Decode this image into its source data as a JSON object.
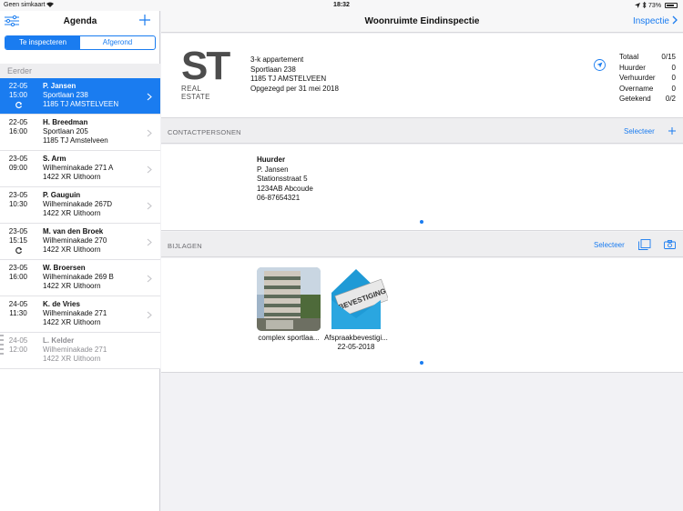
{
  "status_bar": {
    "carrier": "Geen simkaart",
    "time": "18:32",
    "battery": "73%"
  },
  "sidebar": {
    "title": "Agenda",
    "segments": [
      "Te inspecteren",
      "Afgerond"
    ],
    "section": "Eerder",
    "rows": [
      {
        "date": "22-05",
        "time": "15:00",
        "name": "P. Jansen",
        "street": "Sportlaan 238",
        "city": "1185 TJ AMSTELVEEN"
      },
      {
        "date": "22-05",
        "time": "16:00",
        "name": "H. Breedman",
        "street": "Sportlaan 205",
        "city": "1185 TJ Amstelveen"
      },
      {
        "date": "23-05",
        "time": "09:00",
        "name": "S. Arm",
        "street": "Wilheminakade 271 A",
        "city": "1422 XR Uithoorn"
      },
      {
        "date": "23-05",
        "time": "10:30",
        "name": "P. Gauguin",
        "street": "Wilheminakade 267D",
        "city": "1422 XR Uithoorn"
      },
      {
        "date": "23-05",
        "time": "15:15",
        "name": "M. van den Broek",
        "street": "Wilheminakade 270",
        "city": "1422 XR Uithoorn"
      },
      {
        "date": "23-05",
        "time": "16:00",
        "name": "W. Broersen",
        "street": "Wilheminakade 269 B",
        "city": "1422 XR Uithoorn"
      },
      {
        "date": "24-05",
        "time": "11:30",
        "name": "K. de Vries",
        "street": "Wilheminakade 271",
        "city": "1422 XR Uithoorn"
      },
      {
        "date": "24-05",
        "time": "12:00",
        "name": "L. Kelder",
        "street": "Wilheminakade 271",
        "city": "1422 XR Uithoorn"
      }
    ]
  },
  "main": {
    "title": "Woonruimte Eindinspectie",
    "action": "Inspectie",
    "logo": {
      "big": "ST",
      "small": "REAL ESTATE"
    },
    "property": {
      "type": "3-k appartement",
      "street": "Sportlaan 238",
      "city": "1185 TJ AMSTELVEEN",
      "note": "Opgezegd per 31 mei 2018"
    },
    "stats": [
      {
        "label": "Totaal",
        "value": "0/15"
      },
      {
        "label": "Huurder",
        "value": "0"
      },
      {
        "label": "Verhuurder",
        "value": "0"
      },
      {
        "label": "Overname",
        "value": "0"
      },
      {
        "label": "Getekend",
        "value": "0/2"
      }
    ],
    "contacts_section": {
      "title": "CONTACTPERSONEN",
      "select": "Selecteer"
    },
    "contact": {
      "role": "Huurder",
      "name": "P. Jansen",
      "street": "Stationsstraat 5",
      "city": "1234AB Abcoude",
      "phone": "06-87654321"
    },
    "attachments_section": {
      "title": "BIJLAGEN",
      "select": "Selecteer"
    },
    "attachments": [
      {
        "label": "complex sportlaa...",
        "sub": ""
      },
      {
        "label": "Afspraakbevestigi...",
        "sub": "22-05-2018",
        "stamp": "BEVESTIGING"
      }
    ]
  },
  "colors": {
    "accent": "#1a7cf0",
    "logo": "#4d4d4d"
  }
}
